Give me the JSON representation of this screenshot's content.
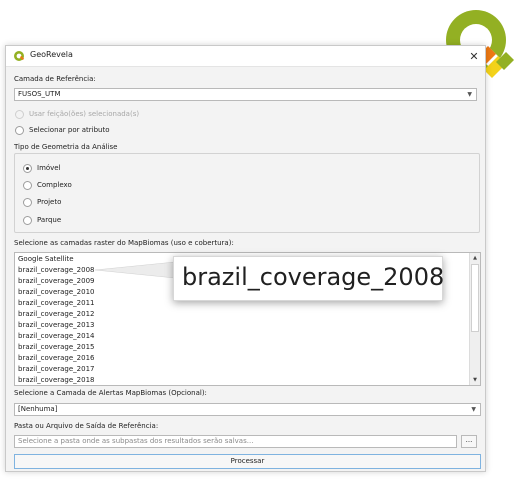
{
  "window": {
    "title": "GeoRevela",
    "close": "✕"
  },
  "reference_layer": {
    "label": "Camada de Referência:",
    "value": "FUSOS_UTM"
  },
  "selection": {
    "use_selected": "Usar feição(ões) selecionada(s)",
    "by_attribute": "Selecionar por atributo"
  },
  "geometry": {
    "label": "Tipo de Geometria da Análise",
    "options": [
      "Imóvel",
      "Complexo",
      "Projeto",
      "Parque"
    ],
    "selected": "Imóvel"
  },
  "raster": {
    "label": "Selecione as camadas raster do MapBiomas (uso e cobertura):",
    "items": [
      "Google Satellite",
      "brazil_coverage_2008",
      "brazil_coverage_2009",
      "brazil_coverage_2010",
      "brazil_coverage_2011",
      "brazil_coverage_2012",
      "brazil_coverage_2013",
      "brazil_coverage_2014",
      "brazil_coverage_2015",
      "brazil_coverage_2016",
      "brazil_coverage_2017",
      "brazil_coverage_2018"
    ]
  },
  "zoom_callout": {
    "text": "brazil_coverage_2008"
  },
  "alerts": {
    "label": "Selecione a Camada de Alertas MapBiomas (Opcional):",
    "value": "[Nenhuma]"
  },
  "output": {
    "label": "Pasta ou Arquivo de Saída de Referência:",
    "placeholder": "Selecione a pasta onde as subpastas dos resultados serão salvas...",
    "browse": "..."
  },
  "process_button": "Processar",
  "icons": [
    "qgis-logo-icon",
    "close-icon",
    "dropdown-arrow-icon",
    "scroll-up-icon",
    "scroll-down-icon"
  ],
  "colors": {
    "qgis_green": "#93b023",
    "qgis_orange": "#ee7913",
    "qgis_yellow": "#f3d21a",
    "button_border": "#7fb3e0"
  }
}
